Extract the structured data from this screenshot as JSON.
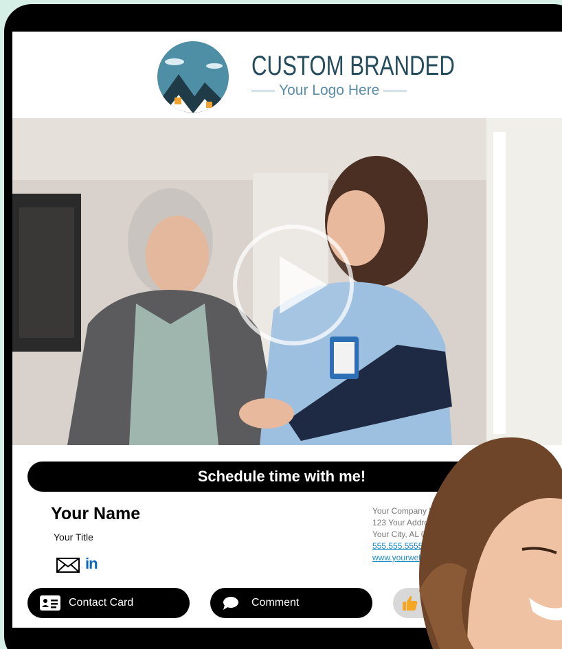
{
  "brand": {
    "title": "CUSTOM BRANDED",
    "subtitle": "Your Logo Here"
  },
  "video": {
    "play_label": "Play video"
  },
  "cta": {
    "label": "Schedule time with me!"
  },
  "signature": {
    "name": "Your Name",
    "title": "Your Title",
    "linkedin_text": "in"
  },
  "company": {
    "name": "Your Company Na",
    "address": "123 Your Address Dr",
    "city": "Your City, AL 000",
    "phone": "555.555.5555",
    "website": "www.yourwebsite"
  },
  "actions": {
    "contact_card": "Contact Card",
    "comment": "Comment"
  },
  "colors": {
    "background": "#d6efe6",
    "frame": "#000000",
    "logo_text": "#244c5c",
    "logo_sky": "#4e8fa6",
    "link": "#1a8bc2",
    "linkedin": "#0a66c2"
  },
  "icons": [
    "house-logo-icon",
    "play-icon",
    "envelope-icon",
    "linkedin-icon",
    "contact-card-icon",
    "comment-bubble-icon",
    "thumbs-up-icon"
  ]
}
